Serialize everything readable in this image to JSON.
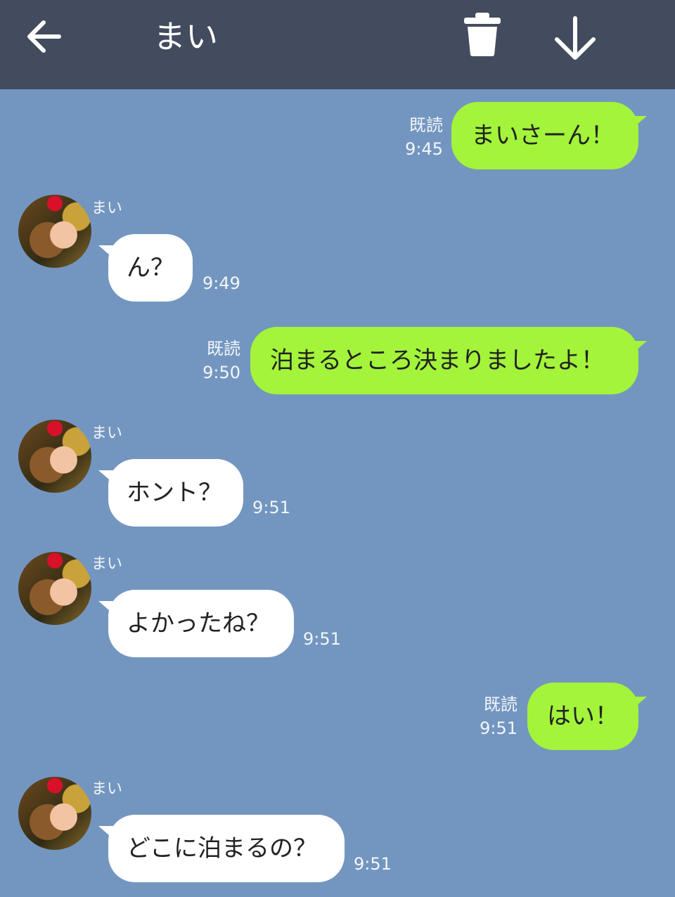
{
  "header": {
    "title": "まい",
    "back_icon": "arrow-left-icon",
    "delete_icon": "trash-icon",
    "download_icon": "arrow-down-icon",
    "background": "#434b5e"
  },
  "colors": {
    "chat_background": "#7396c0",
    "sent_bubble": "#a3f43a",
    "received_bubble": "#ffffff"
  },
  "messages": [
    {
      "direction": "sent",
      "text": "まいさーん！",
      "read": "既読",
      "time": "9:45"
    },
    {
      "direction": "received",
      "sender": "まい",
      "text": "ん？",
      "time": "9:49"
    },
    {
      "direction": "sent",
      "text": "泊まるところ決まりましたよ！",
      "read": "既読",
      "time": "9:50"
    },
    {
      "direction": "received",
      "sender": "まい",
      "text": "ホント？",
      "time": "9:51"
    },
    {
      "direction": "received",
      "sender": "まい",
      "text": "よかったね？",
      "time": "9:51"
    },
    {
      "direction": "sent",
      "text": "はい！",
      "read": "既読",
      "time": "9:51"
    },
    {
      "direction": "received",
      "sender": "まい",
      "text": "どこに泊まるの？",
      "time": "9:51"
    }
  ]
}
